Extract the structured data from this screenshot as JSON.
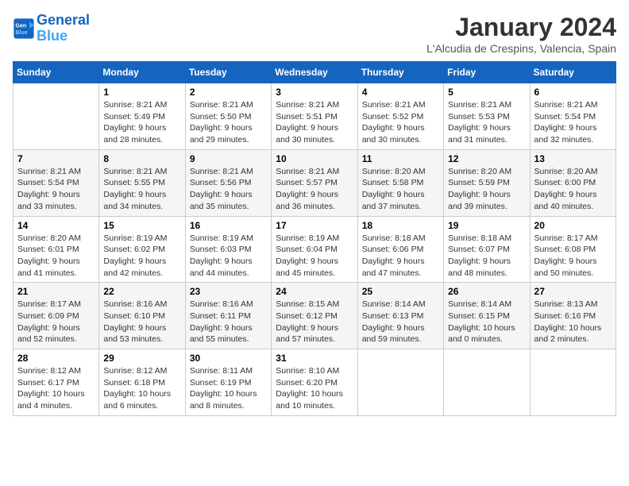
{
  "header": {
    "logo_line1": "General",
    "logo_line2": "Blue",
    "month": "January 2024",
    "location": "L'Alcudia de Crespins, Valencia, Spain"
  },
  "days_of_week": [
    "Sunday",
    "Monday",
    "Tuesday",
    "Wednesday",
    "Thursday",
    "Friday",
    "Saturday"
  ],
  "weeks": [
    [
      {
        "day": "",
        "info": ""
      },
      {
        "day": "1",
        "info": "Sunrise: 8:21 AM\nSunset: 5:49 PM\nDaylight: 9 hours\nand 28 minutes."
      },
      {
        "day": "2",
        "info": "Sunrise: 8:21 AM\nSunset: 5:50 PM\nDaylight: 9 hours\nand 29 minutes."
      },
      {
        "day": "3",
        "info": "Sunrise: 8:21 AM\nSunset: 5:51 PM\nDaylight: 9 hours\nand 30 minutes."
      },
      {
        "day": "4",
        "info": "Sunrise: 8:21 AM\nSunset: 5:52 PM\nDaylight: 9 hours\nand 30 minutes."
      },
      {
        "day": "5",
        "info": "Sunrise: 8:21 AM\nSunset: 5:53 PM\nDaylight: 9 hours\nand 31 minutes."
      },
      {
        "day": "6",
        "info": "Sunrise: 8:21 AM\nSunset: 5:54 PM\nDaylight: 9 hours\nand 32 minutes."
      }
    ],
    [
      {
        "day": "7",
        "info": "Sunrise: 8:21 AM\nSunset: 5:54 PM\nDaylight: 9 hours\nand 33 minutes."
      },
      {
        "day": "8",
        "info": "Sunrise: 8:21 AM\nSunset: 5:55 PM\nDaylight: 9 hours\nand 34 minutes."
      },
      {
        "day": "9",
        "info": "Sunrise: 8:21 AM\nSunset: 5:56 PM\nDaylight: 9 hours\nand 35 minutes."
      },
      {
        "day": "10",
        "info": "Sunrise: 8:21 AM\nSunset: 5:57 PM\nDaylight: 9 hours\nand 36 minutes."
      },
      {
        "day": "11",
        "info": "Sunrise: 8:20 AM\nSunset: 5:58 PM\nDaylight: 9 hours\nand 37 minutes."
      },
      {
        "day": "12",
        "info": "Sunrise: 8:20 AM\nSunset: 5:59 PM\nDaylight: 9 hours\nand 39 minutes."
      },
      {
        "day": "13",
        "info": "Sunrise: 8:20 AM\nSunset: 6:00 PM\nDaylight: 9 hours\nand 40 minutes."
      }
    ],
    [
      {
        "day": "14",
        "info": "Sunrise: 8:20 AM\nSunset: 6:01 PM\nDaylight: 9 hours\nand 41 minutes."
      },
      {
        "day": "15",
        "info": "Sunrise: 8:19 AM\nSunset: 6:02 PM\nDaylight: 9 hours\nand 42 minutes."
      },
      {
        "day": "16",
        "info": "Sunrise: 8:19 AM\nSunset: 6:03 PM\nDaylight: 9 hours\nand 44 minutes."
      },
      {
        "day": "17",
        "info": "Sunrise: 8:19 AM\nSunset: 6:04 PM\nDaylight: 9 hours\nand 45 minutes."
      },
      {
        "day": "18",
        "info": "Sunrise: 8:18 AM\nSunset: 6:06 PM\nDaylight: 9 hours\nand 47 minutes."
      },
      {
        "day": "19",
        "info": "Sunrise: 8:18 AM\nSunset: 6:07 PM\nDaylight: 9 hours\nand 48 minutes."
      },
      {
        "day": "20",
        "info": "Sunrise: 8:17 AM\nSunset: 6:08 PM\nDaylight: 9 hours\nand 50 minutes."
      }
    ],
    [
      {
        "day": "21",
        "info": "Sunrise: 8:17 AM\nSunset: 6:09 PM\nDaylight: 9 hours\nand 52 minutes."
      },
      {
        "day": "22",
        "info": "Sunrise: 8:16 AM\nSunset: 6:10 PM\nDaylight: 9 hours\nand 53 minutes."
      },
      {
        "day": "23",
        "info": "Sunrise: 8:16 AM\nSunset: 6:11 PM\nDaylight: 9 hours\nand 55 minutes."
      },
      {
        "day": "24",
        "info": "Sunrise: 8:15 AM\nSunset: 6:12 PM\nDaylight: 9 hours\nand 57 minutes."
      },
      {
        "day": "25",
        "info": "Sunrise: 8:14 AM\nSunset: 6:13 PM\nDaylight: 9 hours\nand 59 minutes."
      },
      {
        "day": "26",
        "info": "Sunrise: 8:14 AM\nSunset: 6:15 PM\nDaylight: 10 hours\nand 0 minutes."
      },
      {
        "day": "27",
        "info": "Sunrise: 8:13 AM\nSunset: 6:16 PM\nDaylight: 10 hours\nand 2 minutes."
      }
    ],
    [
      {
        "day": "28",
        "info": "Sunrise: 8:12 AM\nSunset: 6:17 PM\nDaylight: 10 hours\nand 4 minutes."
      },
      {
        "day": "29",
        "info": "Sunrise: 8:12 AM\nSunset: 6:18 PM\nDaylight: 10 hours\nand 6 minutes."
      },
      {
        "day": "30",
        "info": "Sunrise: 8:11 AM\nSunset: 6:19 PM\nDaylight: 10 hours\nand 8 minutes."
      },
      {
        "day": "31",
        "info": "Sunrise: 8:10 AM\nSunset: 6:20 PM\nDaylight: 10 hours\nand 10 minutes."
      },
      {
        "day": "",
        "info": ""
      },
      {
        "day": "",
        "info": ""
      },
      {
        "day": "",
        "info": ""
      }
    ]
  ]
}
